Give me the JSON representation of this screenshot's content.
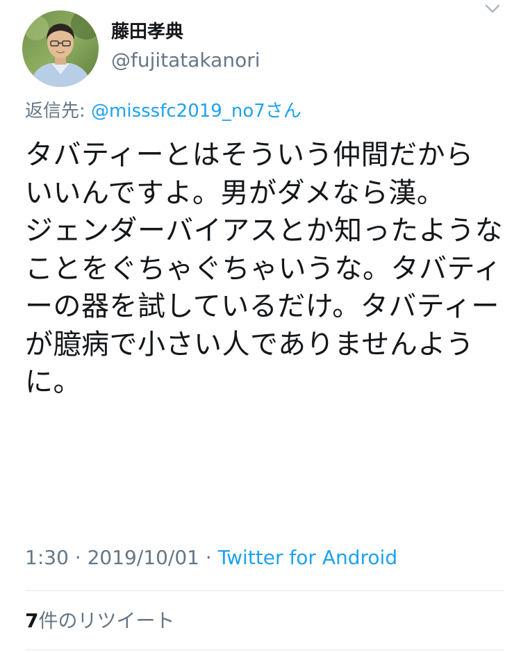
{
  "author": {
    "display_name": "藤田孝典",
    "handle": "@fujitatakanori"
  },
  "reply": {
    "prefix": "返信先: ",
    "target": "@misssfc2019_no7さん"
  },
  "tweet": {
    "text": "タバティーとはそういう仲間だから いいんですよ。男がダメなら漢。\nジェンダーバイアスとか知ったようなことをぐちゃぐちゃいうな。タバティーの器を試しているだけ。タバティーが臆病で小さい人でありませんように。"
  },
  "meta": {
    "time": "1:30",
    "sep1": " · ",
    "date": "2019/10/01",
    "sep2": " · ",
    "source": "Twitter for Android"
  },
  "stats": {
    "retweet_count": "7",
    "retweet_label": "件のリツイート"
  },
  "icons": {
    "menu": "chevron-down-icon",
    "avatar": "profile-photo"
  },
  "colors": {
    "link": "#1da1f2",
    "secondary_text": "#657786",
    "primary_text": "#14171a",
    "divider": "#e1e8ed"
  }
}
